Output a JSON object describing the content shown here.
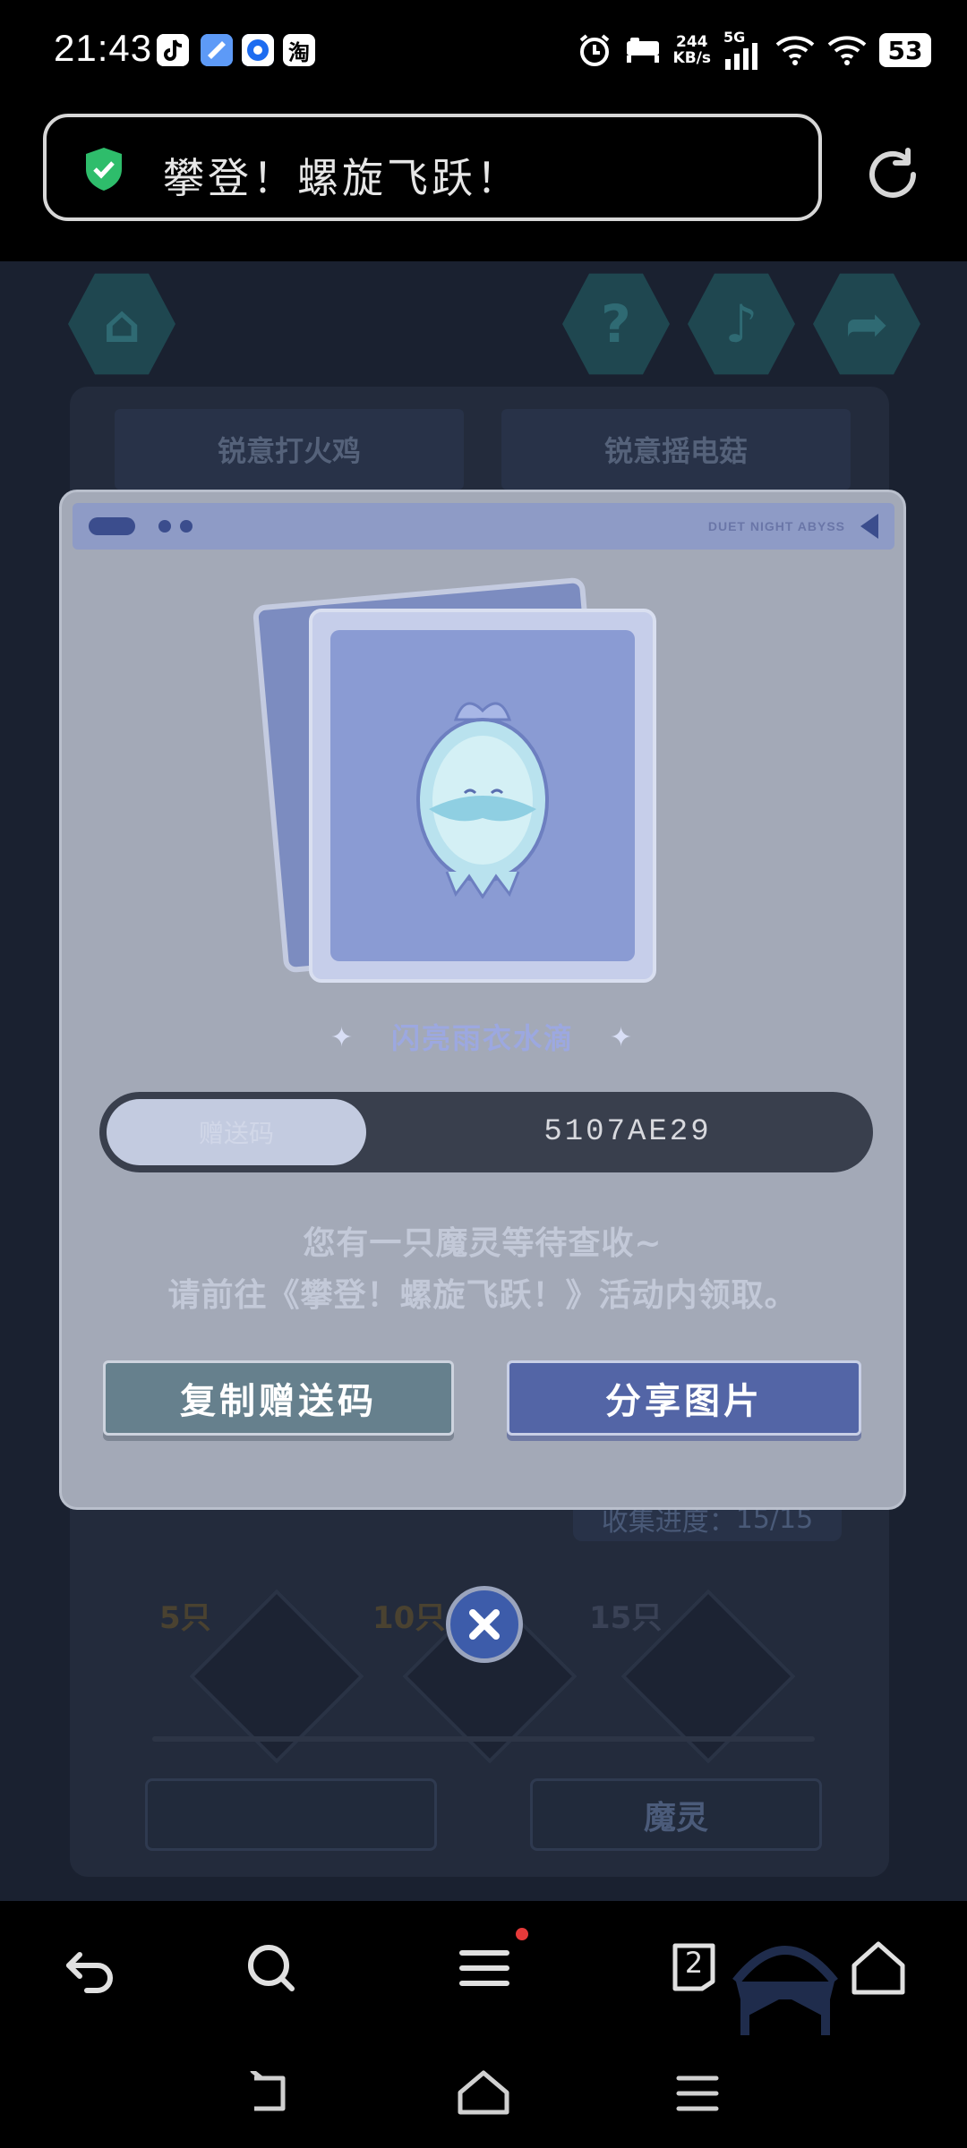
{
  "status_bar": {
    "time": "21:43",
    "app_icons": [
      "tiktok-icon",
      "cloud-app-icon",
      "browser-app-icon",
      "taobao-icon"
    ],
    "taobao_label": "淘",
    "net_speed_value": "244",
    "net_speed_unit": "KB/s",
    "network_type": "5G",
    "battery": "53"
  },
  "browser": {
    "url_text": "攀登！螺旋飞跃！",
    "secure_icon": "shield-check-icon",
    "reload_icon": "reload-icon"
  },
  "game": {
    "top_icons": [
      "home-icon",
      "help-icon",
      "music-icon",
      "share-icon"
    ],
    "tabs": [
      "锐意打火鸡",
      "锐意摇电菇"
    ],
    "progress_label": "收集进度：",
    "progress_value": "15/15",
    "milestones": [
      "5只",
      "10只",
      "15只"
    ],
    "bottom_buttons": [
      "",
      "魔灵"
    ]
  },
  "modal": {
    "header_brand": "DUET NIGHT ABYSS",
    "item_name": "闪亮雨衣水滴",
    "code_tab_label": "赠送码",
    "gift_code": "5107AE29",
    "message_line1": "您有一只魔灵等待查收~",
    "message_line2": "请前往《攀登！螺旋飞跃！》活动内领取。",
    "copy_button": "复制赠送码",
    "share_button": "分享图片",
    "close_icon": "close-icon"
  },
  "bottom_nav": {
    "items": [
      "back-icon",
      "search-icon",
      "menu-icon",
      "tabs-icon",
      "home-icon"
    ],
    "tabs_count": "2"
  },
  "colors": {
    "modal_bg": "#a3a9b7",
    "share_button": "#5365a6",
    "copy_button": "#66808d",
    "secure_green": "#2ebd6b"
  }
}
